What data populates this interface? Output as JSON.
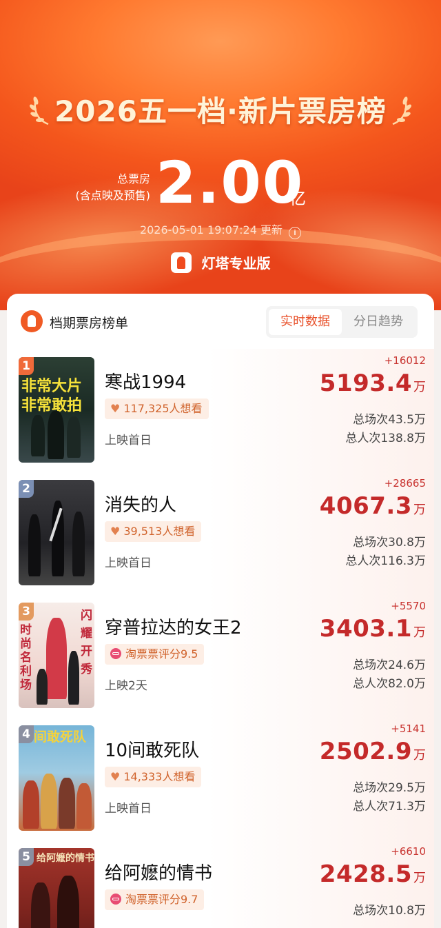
{
  "header": {
    "title": "2026五一档·新片票房榜",
    "total_label_1": "总票房",
    "total_label_2": "(含点映及预售)",
    "total_value": "2.00",
    "total_unit": "亿",
    "update_time": "2026-05-01 19:07:24 更新",
    "brand": "灯塔专业版"
  },
  "board": {
    "title": "档期票房榜单",
    "tabs": [
      "实时数据",
      "分日趋势"
    ],
    "active_tab": "实时数据"
  },
  "movies": [
    {
      "rank": "1",
      "name": "寒战1994",
      "tag_type": "want",
      "tag": "117,325人想看",
      "release": "上映首日",
      "delta": "+16012",
      "box": "5193.4",
      "unit": "万",
      "sessions": "总场次43.5万",
      "admissions": "总人次138.8万",
      "poster_text_1": "非常大片",
      "poster_text_2": "非常敢拍"
    },
    {
      "rank": "2",
      "name": "消失的人",
      "tag_type": "want",
      "tag": "39,513人想看",
      "release": "上映首日",
      "delta": "+28665",
      "box": "4067.3",
      "unit": "万",
      "sessions": "总场次30.8万",
      "admissions": "总人次116.3万"
    },
    {
      "rank": "3",
      "name": "穿普拉达的女王2",
      "tag_type": "score",
      "tag": "淘票票评分9.5",
      "release": "上映2天",
      "delta": "+5570",
      "box": "3403.1",
      "unit": "万",
      "sessions": "总场次24.6万",
      "admissions": "总人次82.0万",
      "poster_text_1": "时尚名利场",
      "poster_text_2": "闪耀开秀"
    },
    {
      "rank": "4",
      "name": "10间敢死队",
      "tag_type": "want",
      "tag": "14,333人想看",
      "release": "上映首日",
      "delta": "+5141",
      "box": "2502.9",
      "unit": "万",
      "sessions": "总场次29.5万",
      "admissions": "总人次71.3万",
      "poster_text_1": "间敢死队"
    },
    {
      "rank": "5",
      "name": "给阿嬷的情书",
      "tag_type": "score",
      "tag": "淘票票评分9.7",
      "release": "",
      "delta": "+6610",
      "box": "2428.5",
      "unit": "万",
      "sessions": "总场次10.8万",
      "admissions": "",
      "poster_text_1": "给阿嬷的情书"
    }
  ],
  "colors": {
    "accent": "#e8502a",
    "box_red": "#c42a2a",
    "rank_1": "#f06a3a",
    "rank_2": "#7b8fb4",
    "rank_3": "#e39a5f",
    "rank_other": "#8a8fa0"
  }
}
